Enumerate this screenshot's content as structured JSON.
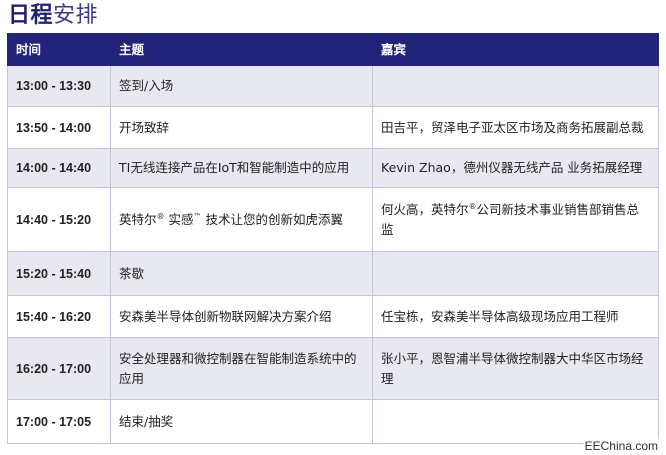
{
  "title": {
    "bold": "日程",
    "rest": "安排"
  },
  "headers": {
    "time": "时间",
    "topic": "主题",
    "guest": "嘉宾"
  },
  "rows": [
    {
      "time": "13:00 - 13:30",
      "topic": "签到/入场",
      "guest": ""
    },
    {
      "time": "13:50 - 14:00",
      "topic": "开场致辞",
      "guest": "田吉平，贸泽电子亚太区市场及商务拓展副总裁"
    },
    {
      "time": "14:00 - 14:40",
      "topic": "TI无线连接产品在IoT和智能制造中的应用",
      "guest": "Kevin Zhao，德州仪器无线产品 业务拓展经理"
    },
    {
      "time": "14:40 - 15:20",
      "topic_a": "英特尔",
      "topic_sup1": "®",
      "topic_b": " 实感",
      "topic_sup2": "™",
      "topic_c": " 技术让您的创新如虎添翼",
      "guest_a": "何火高，英特尔",
      "guest_sup": "®",
      "guest_b": "公司新技术事业销售部销售总监"
    },
    {
      "time": "15:20 - 15:40",
      "topic": "茶歇",
      "guest": ""
    },
    {
      "time": "15:40 - 16:20",
      "topic": "安森美半导体创新物联网解决方案介绍",
      "guest": "任宝栋，安森美半导体高级现场应用工程师"
    },
    {
      "time": "16:20 - 17:00",
      "topic": "安全处理器和微控制器在智能制造系统中的应用",
      "guest": "张小平，恩智浦半导体微控制器大中华区市场经理"
    },
    {
      "time": "17:00 - 17:05",
      "topic": "结束/抽奖",
      "guest": ""
    }
  ],
  "watermark": "EEChina.com"
}
